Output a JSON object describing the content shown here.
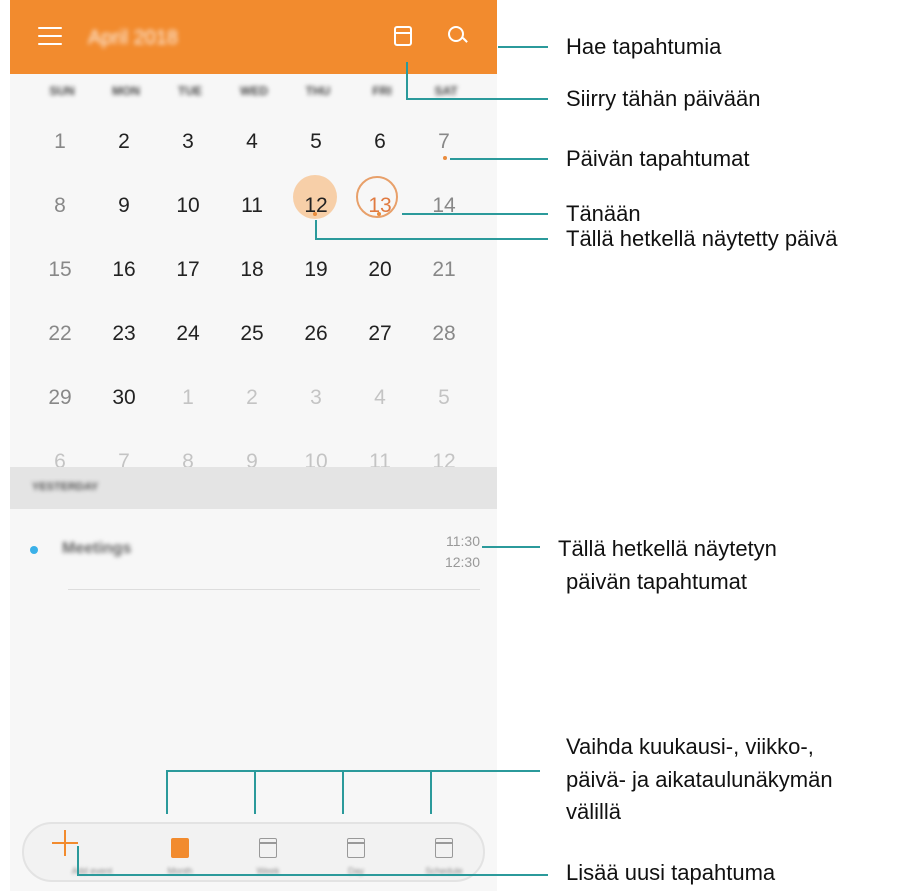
{
  "header": {
    "month_title": "April 2018",
    "goto_today_icon": "calendar-icon",
    "search_icon": "search-icon",
    "menu_icon": "menu-icon",
    "accent_color": "#f28b2e"
  },
  "weekdays": [
    "SUN",
    "MON",
    "TUE",
    "WED",
    "THU",
    "FRI",
    "SAT"
  ],
  "weeks": [
    [
      "1",
      "2",
      "3",
      "4",
      "5",
      "6",
      "7"
    ],
    [
      "8",
      "9",
      "10",
      "11",
      "12",
      "13",
      "14"
    ],
    [
      "15",
      "16",
      "17",
      "18",
      "19",
      "20",
      "21"
    ],
    [
      "22",
      "23",
      "24",
      "25",
      "26",
      "27",
      "28"
    ],
    [
      "29",
      "30",
      "1",
      "2",
      "3",
      "4",
      "5"
    ],
    [
      "6",
      "7",
      "8",
      "9",
      "10",
      "11",
      "12"
    ]
  ],
  "selected_day": "12",
  "today": "13",
  "agenda": {
    "section_label": "YESTERDAY",
    "events": [
      {
        "title": "Meetings",
        "start": "11:30",
        "end": "12:30",
        "color": "#3ab0e8"
      }
    ]
  },
  "bottom_nav": {
    "add_icon": "plus-icon",
    "items": [
      {
        "label": "Add event",
        "icon": "plus-icon"
      },
      {
        "label": "Month",
        "icon": "month-icon",
        "active": true
      },
      {
        "label": "Week",
        "icon": "week-icon"
      },
      {
        "label": "Day",
        "icon": "day-icon"
      },
      {
        "label": "Schedule",
        "icon": "schedule-icon"
      }
    ]
  },
  "annotations": {
    "search": "Hae tapahtumia",
    "goto_today": "Siirry tähän päivään",
    "day_events": "Päivän tapahtumat",
    "today": "Tänään",
    "displayed_day": "Tällä hetkellä näytetty päivä",
    "displayed_events_line1": "Tällä hetkellä näytetyn",
    "displayed_events_line2": "päivän tapahtumat",
    "switch_view_line1": "Vaihda kuukausi-, viikko-,",
    "switch_view_line2": "päivä- ja aikataulunäkymän",
    "switch_view_line3": "välillä",
    "add_event": "Lisää uusi tapahtuma",
    "line_color": "#2b9a9b"
  }
}
